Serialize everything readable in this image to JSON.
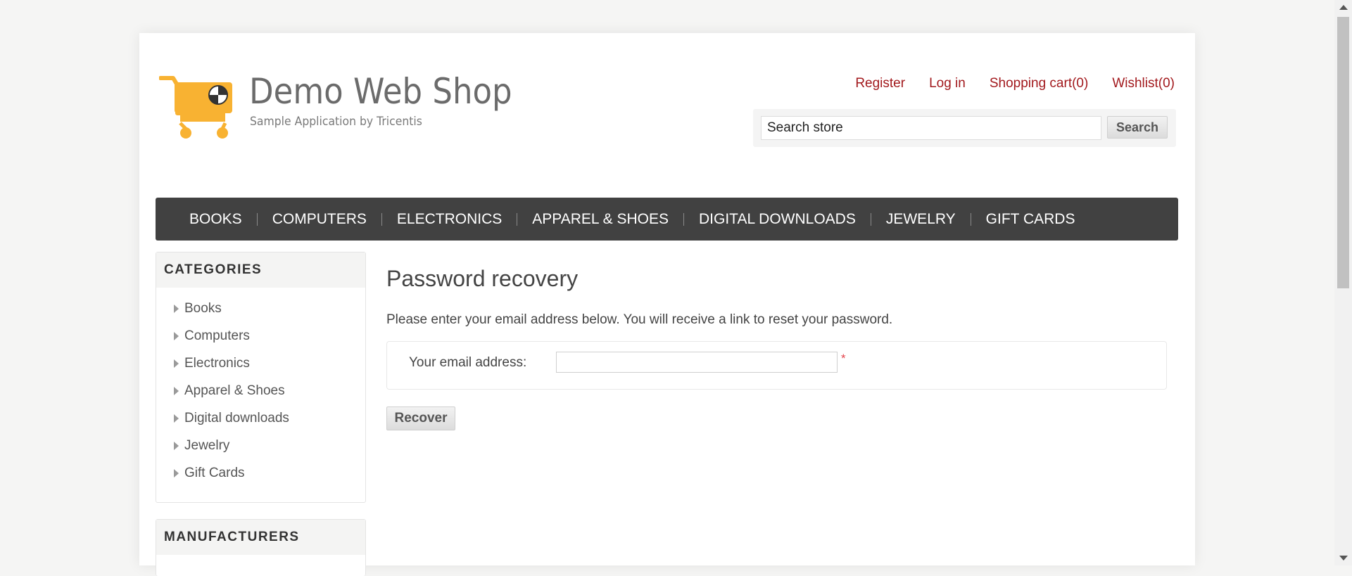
{
  "header": {
    "title": "Demo Web Shop",
    "subtitle": "Sample Application by Tricentis",
    "links": {
      "register": "Register",
      "login": "Log in",
      "cart": "Shopping cart(0)",
      "wishlist": "Wishlist(0)"
    },
    "search": {
      "value": "Search store",
      "button": "Search"
    }
  },
  "top_menu": [
    "BOOKS",
    "COMPUTERS",
    "ELECTRONICS",
    "APPAREL & SHOES",
    "DIGITAL DOWNLOADS",
    "JEWELRY",
    "GIFT CARDS"
  ],
  "sidebar": {
    "categories_title": "CATEGORIES",
    "categories": [
      "Books",
      "Computers",
      "Electronics",
      "Apparel & Shoes",
      "Digital downloads",
      "Jewelry",
      "Gift Cards"
    ],
    "manufacturers_title": "MANUFACTURERS"
  },
  "main": {
    "title": "Password recovery",
    "description": "Please enter your email address below. You will receive a link to reset your password.",
    "email_label": "Your email address:",
    "email_value": "",
    "required_mark": "*",
    "recover_button": "Recover"
  },
  "colors": {
    "link": "#a2191d",
    "menu_bg": "#414141",
    "logo_cart": "#f8b232",
    "required": "#e4444c"
  },
  "icons": {
    "logo": "shopping-cart-icon",
    "category_bullet": "triangle-right-icon"
  }
}
